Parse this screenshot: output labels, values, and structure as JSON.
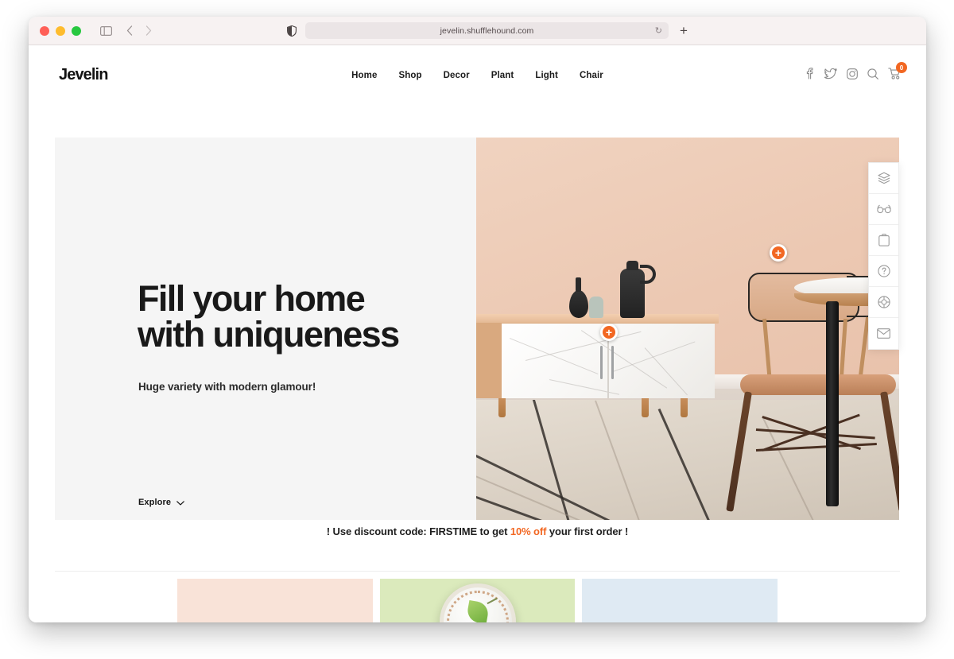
{
  "browser": {
    "url": "jevelin.shufflehound.com",
    "reload_icon": "reload-icon",
    "new_tab_icon": "plus-icon",
    "shield_icon": "shield-icon",
    "sidebar_icon": "sidebar-toggle-icon",
    "back_icon": "chevron-left-icon",
    "forward_icon": "chevron-right-icon"
  },
  "site": {
    "logo": "Jevelin",
    "nav": [
      {
        "label": "Home"
      },
      {
        "label": "Shop"
      },
      {
        "label": "Decor"
      },
      {
        "label": "Plant"
      },
      {
        "label": "Light"
      },
      {
        "label": "Chair"
      }
    ],
    "header_icons": [
      {
        "name": "facebook-icon"
      },
      {
        "name": "twitter-icon"
      },
      {
        "name": "instagram-icon"
      },
      {
        "name": "search-icon"
      },
      {
        "name": "cart-icon"
      }
    ],
    "cart_count": "0"
  },
  "hero": {
    "title": "Fill your home\nwith uniqueness",
    "subtitle": "Huge variety with modern glamour!",
    "explore_label": "Explore",
    "chevron_icon": "chevron-down-icon",
    "hotspots": [
      {
        "label": "+"
      },
      {
        "label": "+"
      }
    ]
  },
  "side_toolbar": [
    {
      "name": "layers-icon"
    },
    {
      "name": "glasses-icon"
    },
    {
      "name": "clipboard-icon"
    },
    {
      "name": "question-mark-icon"
    },
    {
      "name": "lifebuoy-icon"
    },
    {
      "name": "envelope-icon"
    }
  ],
  "promo": {
    "prefix": "! Use discount code: FIRSTIME to get ",
    "accent": "10% off",
    "suffix": " your first order !"
  },
  "cards": [
    {
      "name": "card-peach"
    },
    {
      "name": "card-green-plate"
    },
    {
      "name": "card-blue"
    }
  ],
  "colors": {
    "accent": "#f26722",
    "text": "#191919",
    "hero_left_bg": "#f5f5f5",
    "card_peach": "#f9e3d8",
    "card_green": "#dbeabc",
    "card_blue": "#dfeaf3",
    "wall": "#ecc8b2"
  }
}
